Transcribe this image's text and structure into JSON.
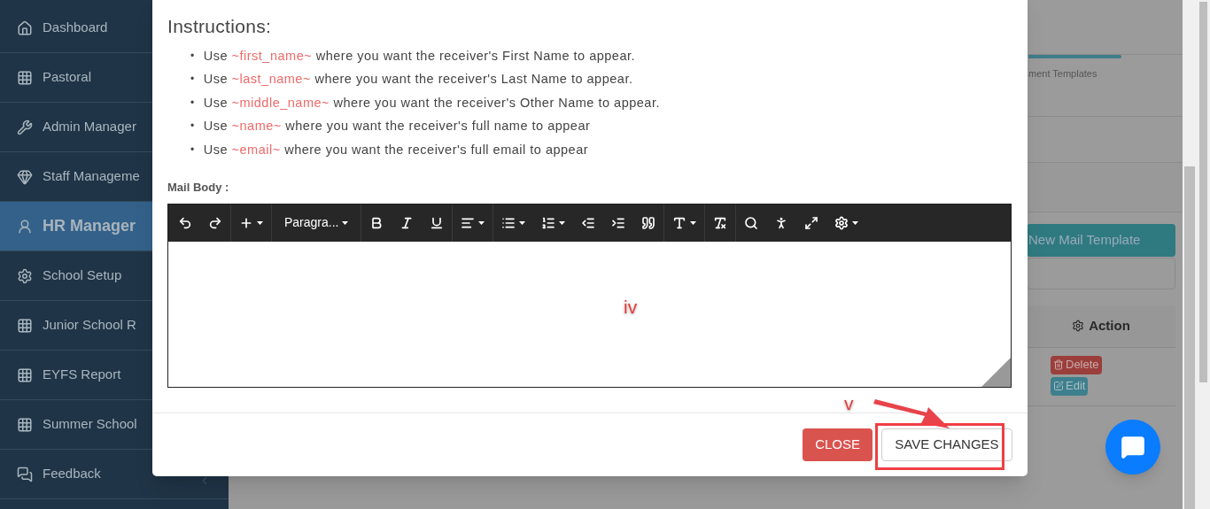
{
  "sidebar": {
    "items": [
      {
        "label": "Dashboard",
        "selected": false
      },
      {
        "label": "Pastoral",
        "selected": false
      },
      {
        "label": "Admin Manager",
        "selected": false
      },
      {
        "label": "Staff Manageme",
        "selected": false
      },
      {
        "label": "HR Manager",
        "selected": true
      },
      {
        "label": "School Setup",
        "selected": false
      },
      {
        "label": "Junior School R",
        "selected": false
      },
      {
        "label": "EYFS Report",
        "selected": false
      },
      {
        "label": "Summer School",
        "selected": false
      },
      {
        "label": "Feedback",
        "selected": false
      }
    ]
  },
  "background_page": {
    "tab": "ment Templates",
    "new_button": "New Mail Template",
    "action_header": "Action",
    "row_buttons": [
      "Delete",
      "Edit"
    ]
  },
  "modal": {
    "instructions_title": "Instructions:",
    "instructions": [
      {
        "bullet": "•",
        "lead": "Use",
        "tag": "~first_name~",
        "rest": "where you want the receiver's First Name to appear."
      },
      {
        "bullet": "•",
        "lead": "Use",
        "tag": "~last_name~",
        "rest": "where you want the receiver's Last Name to appear."
      },
      {
        "bullet": "•",
        "lead": "Use",
        "tag": "~middle_name~",
        "rest": "where you want the receiver's Other Name to appear."
      },
      {
        "bullet": "•",
        "lead": "Use",
        "tag": "~name~",
        "rest": "where you want the receiver's full name to appear"
      },
      {
        "bullet": "•",
        "lead": "Use",
        "tag": "~email~",
        "rest": "where you want the receiver's full email to appear"
      }
    ],
    "body_label": "Mail Body :",
    "format_dropdown": "Paragra...",
    "buttons": {
      "close": "CLOSE",
      "save": "SAVE CHANGES"
    }
  },
  "annotations": [
    "iv",
    "v"
  ]
}
